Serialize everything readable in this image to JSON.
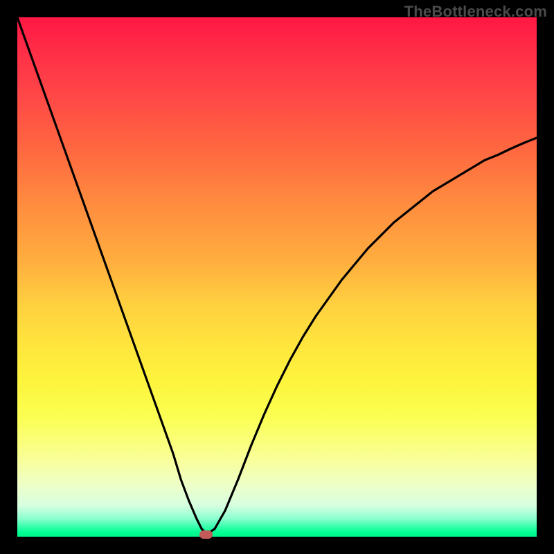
{
  "watermark": "TheBottleneck.com",
  "colors": {
    "background": "#000000",
    "curve": "#000000",
    "marker": "#c25b5a",
    "gradient_top": "#ff1744",
    "gradient_bottom": "#00f58b"
  },
  "chart_data": {
    "type": "line",
    "title": "",
    "xlabel": "",
    "ylabel": "",
    "xlim": [
      0,
      100
    ],
    "ylim": [
      0,
      100
    ],
    "x": [
      0,
      2.5,
      5,
      7.5,
      10,
      12.5,
      15,
      17.5,
      20,
      22.5,
      25,
      27.5,
      30,
      31.5,
      33,
      34.5,
      35.5,
      36.5,
      38,
      40,
      42.5,
      45,
      47.5,
      50,
      52.5,
      55,
      57.5,
      60,
      62.5,
      65,
      67.5,
      70,
      72.5,
      75,
      77.5,
      80,
      82.5,
      85,
      87.5,
      90,
      92.5,
      95,
      97.5,
      100
    ],
    "values": [
      100,
      93,
      86,
      79,
      72,
      65,
      58,
      51,
      44,
      37,
      30,
      23,
      16,
      11,
      7,
      3.5,
      1.5,
      0.5,
      1.5,
      5,
      11,
      17.5,
      23.5,
      29,
      34,
      38.5,
      42.5,
      46,
      49.5,
      52.5,
      55.5,
      58,
      60.5,
      62.5,
      64.5,
      66.5,
      68,
      69.5,
      71,
      72.5,
      73.5,
      74.7,
      75.8,
      76.8
    ],
    "marker": {
      "x": 36.3,
      "y": 0,
      "color": "#c25b5a"
    },
    "annotations": []
  }
}
